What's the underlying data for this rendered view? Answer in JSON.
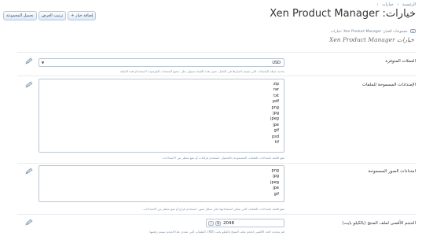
{
  "breadcrumb": [
    "الرئيسية",
    "خيارات"
  ],
  "title": "Xen Product Manager :خيارات",
  "toolbar": {
    "add_option": "+ إضافة خيار",
    "display_order": "ترتيب العرض",
    "import_export": "تحميل المجموعة"
  },
  "options_header": "مجموعات الخيار: Xen Product Manager :خيارات",
  "section_title": "Xen Product Manager خيارات",
  "options": [
    {
      "label": "العملات المتوفرة",
      "type": "select",
      "value": "USD",
      "hint": "تحديد عملة المنتجات التي سيتم اختيارها في الحقل. تغيير هذه القيمة سيؤثر على جميع المنتجات الموجودة لاستخدام هذه العملة."
    },
    {
      "label": "الإمتدادات المسموحة للملفات",
      "type": "textarea",
      "lines": [
        "zip",
        "rar",
        "txt",
        "pdf",
        "png",
        "jpg",
        "jpeg",
        "jpe",
        "gif",
        "psd",
        "tif"
      ],
      "hint": "ضع قائمة بامتدادات الملفات المسموحة بالتحميل. استخدم فراغات أو ضع سطر بين الامتدادات."
    },
    {
      "label": "امتدادات الصور المسموحة",
      "type": "textarea",
      "lines": [
        "png",
        "jpg",
        "jpeg",
        "jpe",
        "gif"
      ],
      "hint": "ضع قائمة بامتدادات الملفات التي يمكن استخدامها على شكل صور. استخدم فراغ أو ضع سطر بين الامتدادات."
    },
    {
      "label": "الحجم الأقصى لملف المنتج (بالكيلو بايت)",
      "type": "stepper",
      "value": "2048",
      "hint": "قم بتحديد الحد الأقصى لحجم ملف المنتج بالكيلو بايت (KB). الملفات التي تتعدى هذا الحجم سيتم رفضها."
    }
  ]
}
